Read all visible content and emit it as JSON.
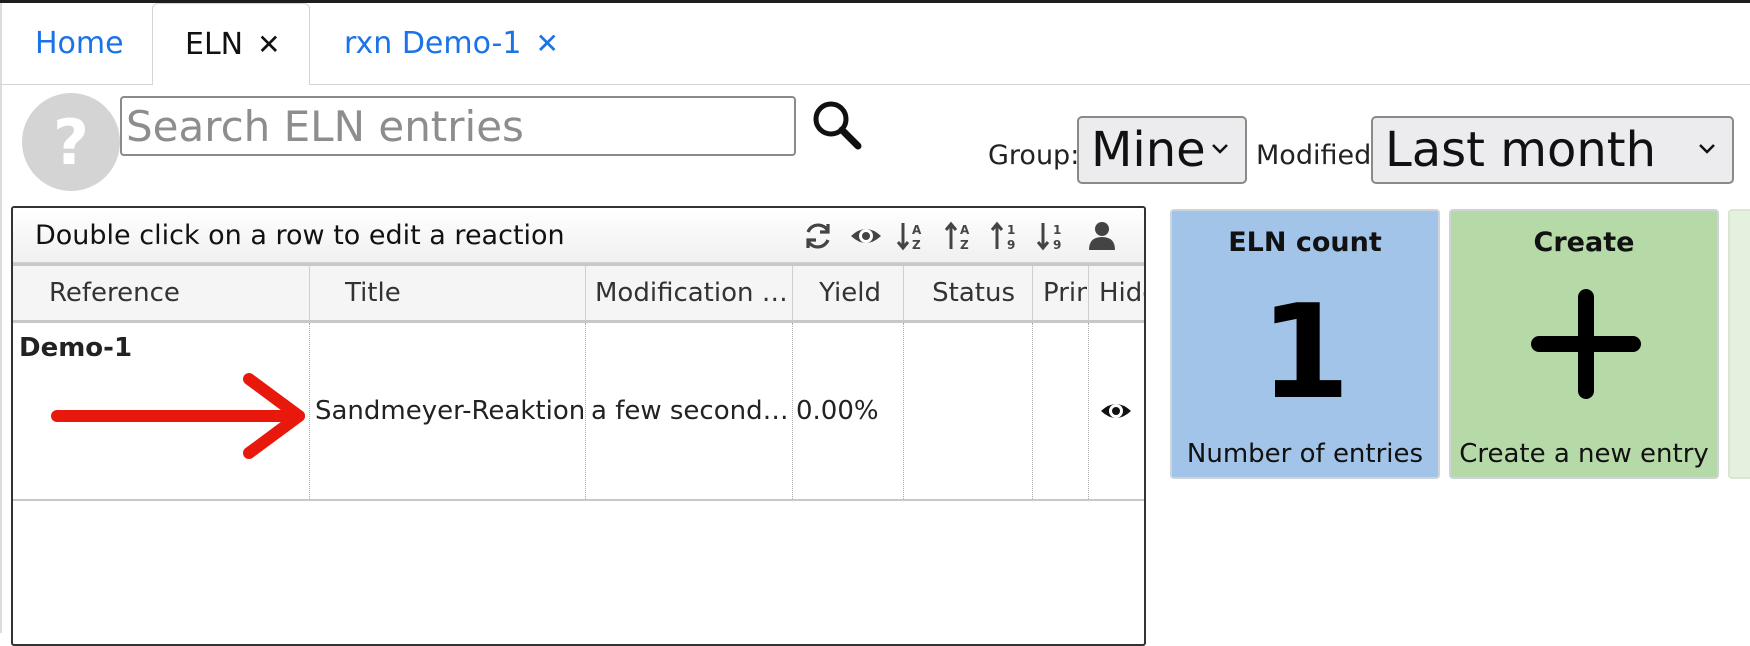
{
  "tabs": [
    {
      "label": "Home"
    },
    {
      "label": "ELN",
      "close": "✕"
    },
    {
      "label": "rxn Demo-1",
      "close": "✕"
    }
  ],
  "help": {
    "glyph": "?"
  },
  "search": {
    "placeholder": "Search ELN entries",
    "value": ""
  },
  "filters": {
    "group_label": "Group:",
    "group_value": "Mine",
    "modified_label": "Modified:",
    "modified_value": "Last month"
  },
  "panel": {
    "title": "Double click on a row to edit a reaction",
    "toolbar_icons": [
      "refresh-icon",
      "eye-icon",
      "sort-alpha-down-icon",
      "sort-alpha-up-icon",
      "sort-numeric-up-icon",
      "sort-numeric-down-icon",
      "user-icon"
    ]
  },
  "table": {
    "columns": [
      "Reference",
      "Title",
      "Modification …",
      "Yield",
      "Status",
      "Prin",
      "Hide"
    ],
    "rows": [
      {
        "reference": "Demo-1",
        "title": "Sandmeyer-Reaktion",
        "modified": "a few second…",
        "yield": "0.00%",
        "status": "",
        "print": "",
        "hide_icon": "eye-icon"
      }
    ]
  },
  "annotation": {
    "arrow_color": "#e8190c"
  },
  "cards": [
    {
      "title": "ELN count",
      "value": "1",
      "caption": "Number of entries",
      "color": "#a2c4e8"
    },
    {
      "title": "Create",
      "value": "+",
      "caption": "Create a new entry",
      "color": "#b5d9a7"
    }
  ],
  "colors": {
    "accent": "#1a73e8"
  }
}
